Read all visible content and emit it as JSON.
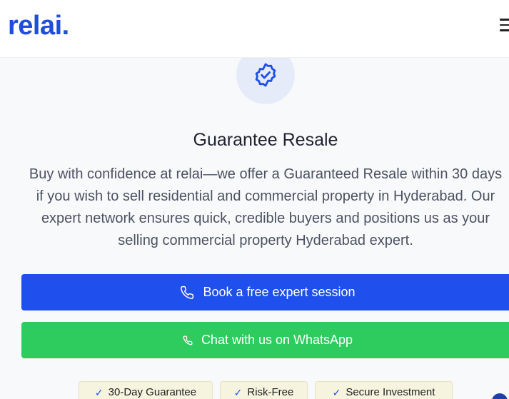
{
  "header": {
    "logo_text": "relai.",
    "menu_icon": "hamburger-icon"
  },
  "hero": {
    "badge_icon": "verified-badge-icon",
    "title": "Guarantee Resale",
    "description": "Buy with confidence at relai—we offer a Guaranteed Resale within 30 days if you wish to sell residential and commercial property in Hyderabad. Our expert network ensures quick, credible buyers and positions us as your selling commercial property Hyderabad expert."
  },
  "actions": {
    "book_label": "Book a free expert session",
    "book_icon": "phone-icon",
    "whatsapp_label": "Chat with us on WhatsApp",
    "whatsapp_icon": "phone-icon"
  },
  "features": [
    {
      "label": "30-Day Guarantee",
      "icon": "check-icon"
    },
    {
      "label": "Risk-Free",
      "icon": "check-icon"
    },
    {
      "label": "Secure Investment",
      "icon": "check-icon"
    }
  ],
  "colors": {
    "brand_blue": "#1f4dec",
    "whatsapp_green": "#2ecc5f",
    "pill_bg": "#f6f4df"
  }
}
